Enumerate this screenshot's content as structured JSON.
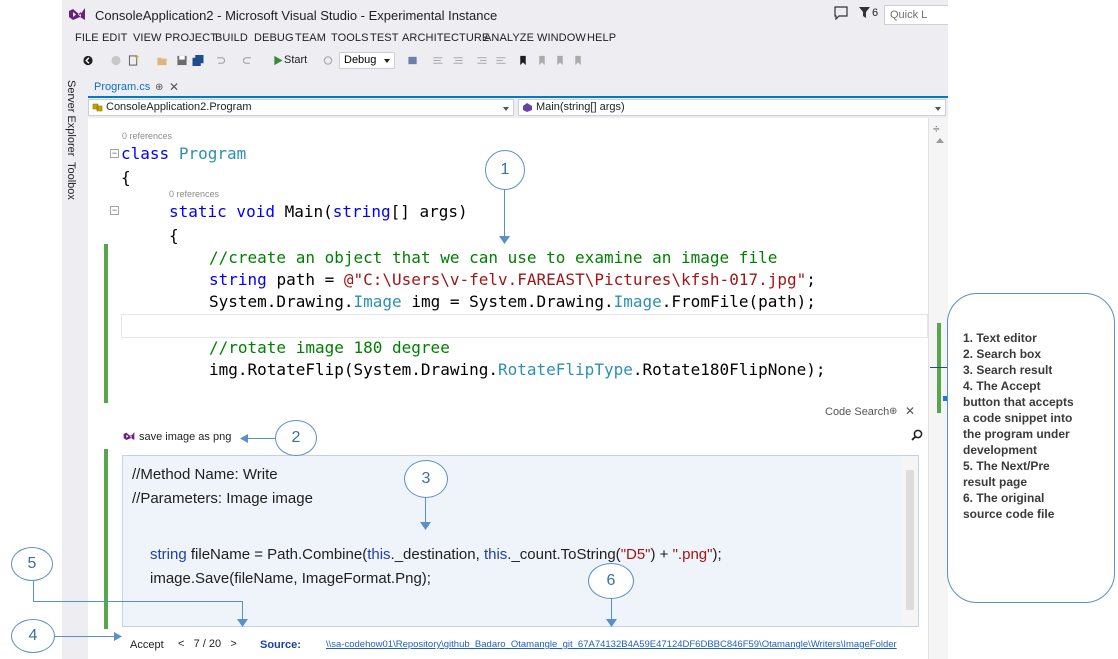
{
  "window": {
    "title": "ConsoleApplication2 - Microsoft Visual Studio - Experimental Instance",
    "notifications_count": "6",
    "quick_launch_placeholder": "Quick L"
  },
  "menu": [
    "FILE",
    "EDIT",
    "VIEW",
    "PROJECT",
    "BUILD",
    "DEBUG",
    "TEAM",
    "TOOLS",
    "TEST",
    "ARCHITECTURE",
    "ANALYZE",
    "WINDOW",
    "HELP"
  ],
  "toolbar": {
    "start_label": "Start",
    "config_value": "Debug"
  },
  "side_tabs": [
    "Server Explorer",
    "Toolbox"
  ],
  "document_tab": {
    "name": "Program.cs",
    "pin": "⊕",
    "close": "✕"
  },
  "navigation": {
    "class_combo": "ConsoleApplication2.Program",
    "member_combo": "Main(string[] args)"
  },
  "code": {
    "references_class": "0 references",
    "references_main": "0 references",
    "line1_kw": "class",
    "line1_name": "Program",
    "brace_open": "{",
    "line2_mod": "static void",
    "line2_rest": "Main(",
    "line2_type": "string",
    "line2_end": "[] args)",
    "brace_open2": "{",
    "comment1": "//create an object that we can use to examine an image file",
    "line_path_kw": "string",
    "line_path_mid": "path = ",
    "line_path_str": "@\"C:\\Users\\v-felv.FAREAST\\Pictures\\kfsh-017.jpg\"",
    "line_path_end": ";",
    "line_img_a": "System.Drawing.",
    "line_img_type": "Image",
    "line_img_b": "img = System.Drawing.",
    "line_img_type2": "Image",
    "line_img_c": ".FromFile(path);",
    "comment2": "//rotate image 180 degree",
    "line_rot_a": "img.RotateFlip(System.Drawing.",
    "line_rot_type": "RotateFlipType",
    "line_rot_b": ".Rotate180FlipNone);"
  },
  "code_search": {
    "panel_title": "Code Search",
    "pin": "⊕",
    "close": "✕",
    "query": "save image as png",
    "result": {
      "line1": "//Method Name: Write",
      "line2": "//Parameters: Image image",
      "l3_kw": "string",
      "l3_a": " fileName = Path.Combine(",
      "l3_this1": "this",
      "l3_b": "._destination, ",
      "l3_this2": "this",
      "l3_c": "._count.ToString(",
      "l3_str1": "\"D5\"",
      "l3_d": ") + ",
      "l3_str2": "\".png\"",
      "l3_e": ");",
      "line4": "image.Save(fileName, ImageFormat.Png);"
    },
    "accept_label": "Accept",
    "prev_symbol": "<",
    "page_current": "7",
    "page_sep": "/",
    "page_total": "20",
    "next_symbol": ">",
    "source_label": "Source:",
    "source_path": "\\\\sa-codehow01\\Repository\\github_Badaro_Otamangle_git_67A74132B4A59E47124DF6DBBC846F59\\Otamangle\\Writers\\ImageFolder"
  },
  "callouts": [
    "1",
    "2",
    "3",
    "4",
    "5",
    "6"
  ],
  "legend": [
    "1. Text editor",
    "2. Search box",
    "3. Search result",
    "4. The Accept",
    "button that accepts",
    "a code snippet into",
    "the program under",
    "development",
    "5. The Next/Pre",
    "result page",
    "6. The original",
    "source code file"
  ],
  "colors": {
    "vs_purple": "#68217a",
    "keyword": "#0000ff",
    "type": "#2b91af",
    "string": "#a31515",
    "comment": "#008000",
    "change_bar": "#57a64a",
    "annotation": "#5b8fc7"
  }
}
